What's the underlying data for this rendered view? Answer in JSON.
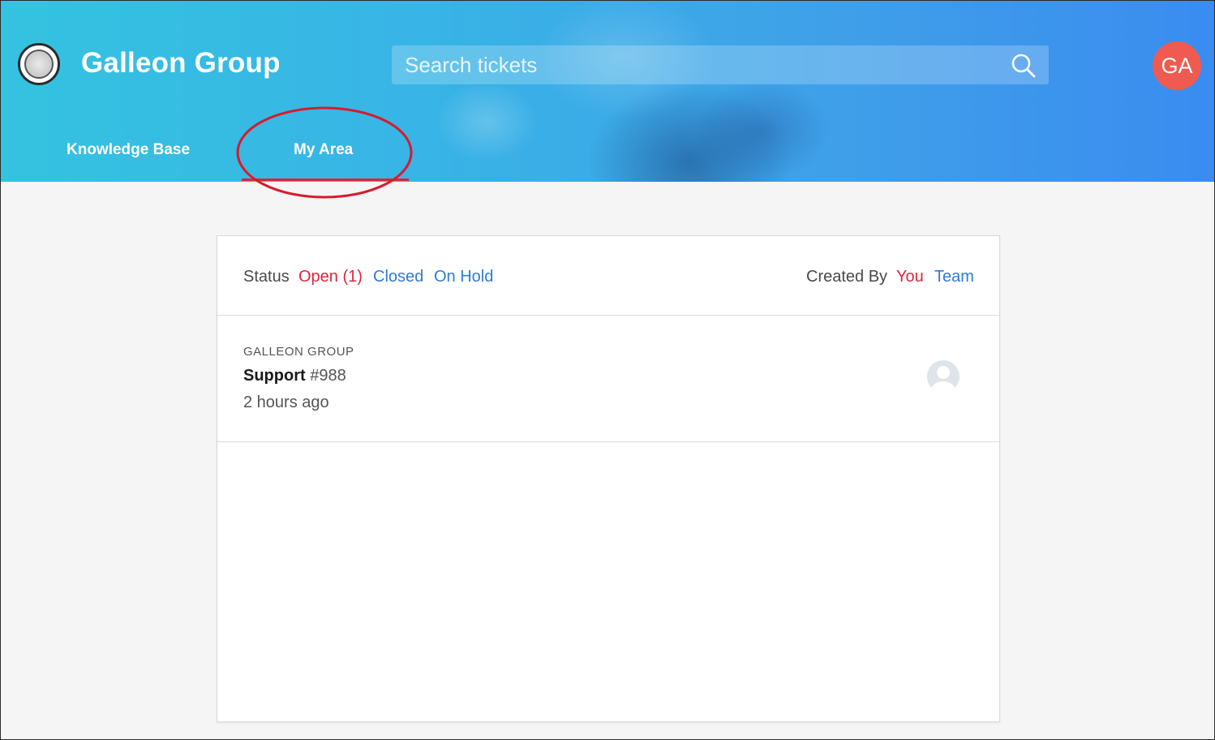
{
  "header": {
    "brand": "Galleon Group",
    "search": {
      "placeholder": "Search tickets"
    },
    "user_initials": "GA",
    "nav": [
      {
        "label": "Knowledge Base"
      },
      {
        "label": "My Area",
        "active": true
      }
    ],
    "colors": {
      "accent": "#e0243a",
      "avatar": "#ef5b50"
    }
  },
  "filters": {
    "status_label": "Status",
    "open": "Open (1)",
    "closed": "Closed",
    "on_hold": "On Hold",
    "created_by_label": "Created By",
    "you": "You",
    "team": "Team"
  },
  "tickets": [
    {
      "org": "GALLEON GROUP",
      "title": "Support",
      "number": "#988",
      "time": "2 hours ago",
      "avatar_icon": "user-avatar-icon"
    }
  ]
}
